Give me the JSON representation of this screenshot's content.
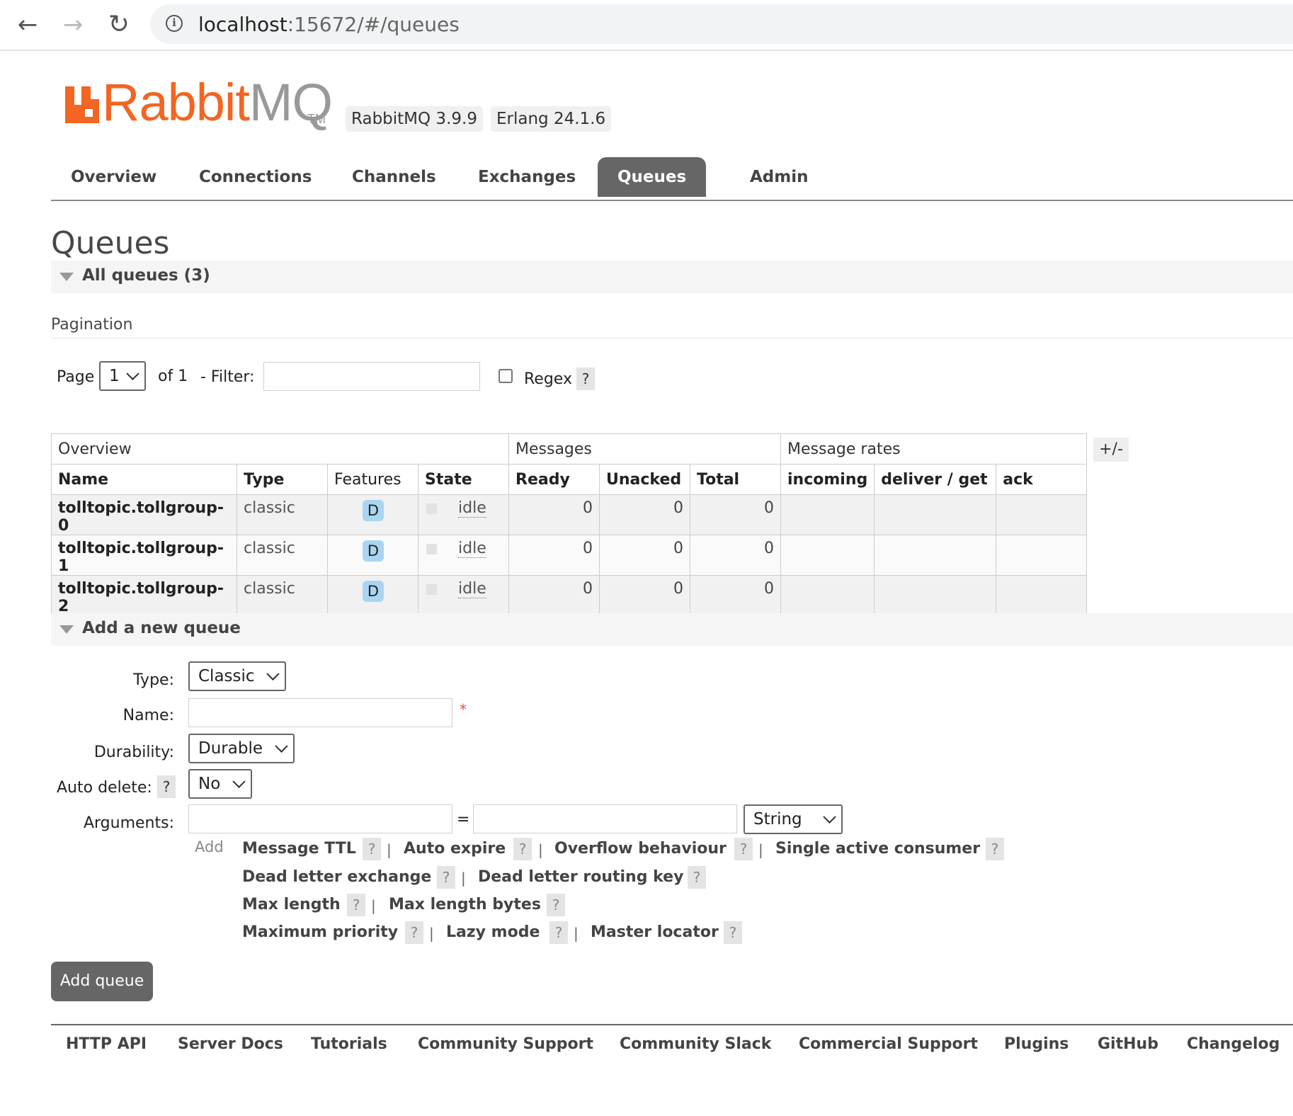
{
  "browser": {
    "url_host": "localhost",
    "url_path": ":15672/#/queues"
  },
  "header": {
    "logo_rabbit": "Rabbit",
    "logo_mq": "MQ",
    "logo_tm": "TM",
    "rabbitmq_version": "RabbitMQ 3.9.9",
    "erlang_version": "Erlang 24.1.6"
  },
  "tabs": [
    {
      "label": "Overview"
    },
    {
      "label": "Connections"
    },
    {
      "label": "Channels"
    },
    {
      "label": "Exchanges"
    },
    {
      "label": "Queues",
      "active": true
    },
    {
      "label": "Admin"
    }
  ],
  "page_title": "Queues",
  "all_queues": {
    "label": "All queues (3)",
    "pagination_label": "Pagination",
    "page_label": "Page",
    "page_value": "1",
    "of_label": "of 1",
    "filter_label": "- Filter:",
    "filter_value": "",
    "regex_label": "Regex",
    "help_label": "?",
    "plus_minus": "+/-"
  },
  "table": {
    "groups": [
      "Overview",
      "Messages",
      "Message rates"
    ],
    "columns": [
      "Name",
      "Type",
      "Features",
      "State",
      "Ready",
      "Unacked",
      "Total",
      "incoming",
      "deliver / get",
      "ack"
    ],
    "rows": [
      {
        "name": "tolltopic.tollgroup-0",
        "type": "classic",
        "feature": "D",
        "state": "idle",
        "ready": "0",
        "unacked": "0",
        "total": "0"
      },
      {
        "name": "tolltopic.tollgroup-1",
        "type": "classic",
        "feature": "D",
        "state": "idle",
        "ready": "0",
        "unacked": "0",
        "total": "0"
      },
      {
        "name": "tolltopic.tollgroup-2",
        "type": "classic",
        "feature": "D",
        "state": "idle",
        "ready": "0",
        "unacked": "0",
        "total": "0"
      }
    ]
  },
  "add_queue": {
    "section_label": "Add a new queue",
    "type_label": "Type:",
    "type_value": "Classic",
    "name_label": "Name:",
    "name_value": "",
    "required_mark": "*",
    "durability_label": "Durability:",
    "durability_value": "Durable",
    "auto_delete_label": "Auto delete:",
    "auto_delete_value": "No",
    "arguments_label": "Arguments:",
    "equals": "=",
    "arg_type_value": "String",
    "add_label": "Add",
    "separator": "|",
    "arg_links": [
      "Message TTL",
      "Auto expire",
      "Overflow behaviour",
      "Single active consumer",
      "Dead letter exchange",
      "Dead letter routing key",
      "Max length",
      "Max length bytes",
      "Maximum priority",
      "Lazy mode",
      "Master locator"
    ],
    "submit_label": "Add queue"
  },
  "footer": {
    "links": [
      "HTTP API",
      "Server Docs",
      "Tutorials",
      "Community Support",
      "Community Slack",
      "Commercial Support",
      "Plugins",
      "GitHub",
      "Changelog"
    ]
  }
}
